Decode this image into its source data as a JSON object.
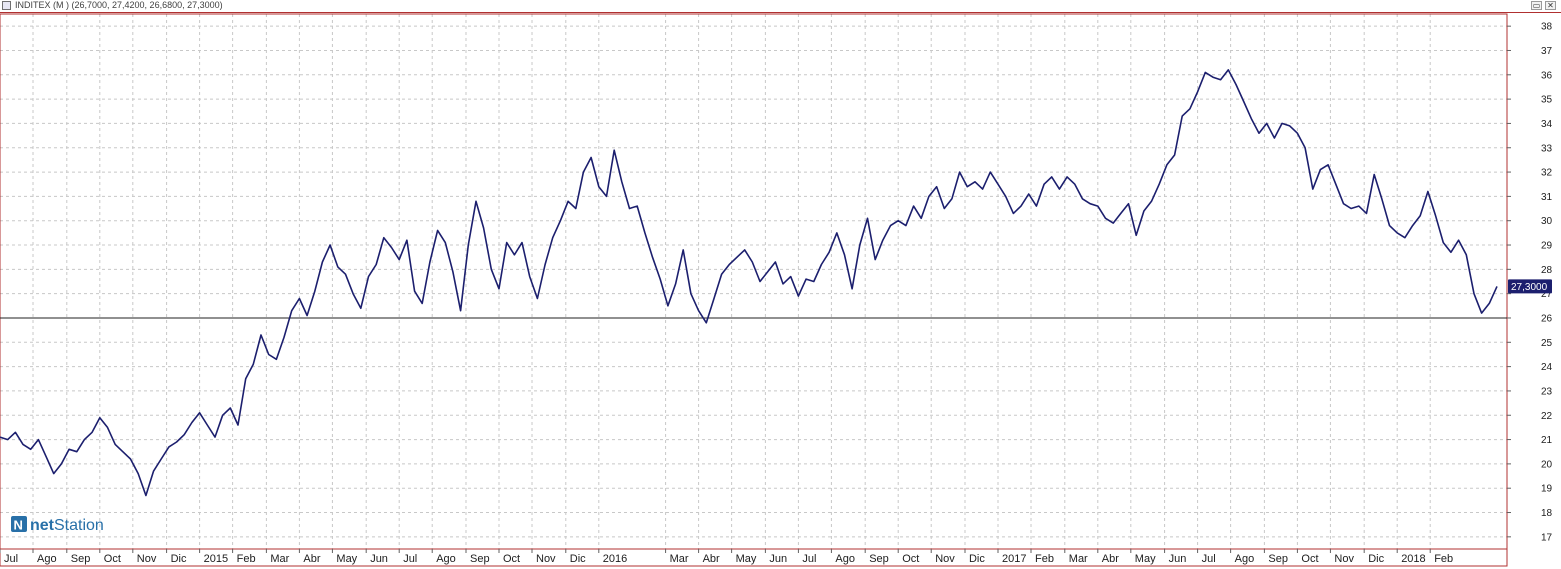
{
  "window": {
    "title": "INDITEX (M ) (26,7000, 27,4200, 26,6800, 27,3000)",
    "restore_symbol": "▭",
    "close_symbol": "✕"
  },
  "watermark": {
    "logo_letter": "N",
    "brand_bold": "net",
    "brand_rest": "Station"
  },
  "colors": {
    "price_line": "#1c1f6e",
    "frame": "#b03030",
    "grid": "#c8c8c8",
    "label_bg": "#1c1f6e",
    "logo": "#2870a8"
  },
  "chart_data": {
    "type": "line",
    "series": [
      {
        "name": "INDITEX",
        "values": [
          21.1,
          21.0,
          21.3,
          20.8,
          20.6,
          21.0,
          20.3,
          19.6,
          20.0,
          20.6,
          20.5,
          21.0,
          21.3,
          21.9,
          21.5,
          20.8,
          20.5,
          20.2,
          19.6,
          18.7,
          19.7,
          20.2,
          20.7,
          20.9,
          21.2,
          21.7,
          22.1,
          21.6,
          21.1,
          22.0,
          22.3,
          21.6,
          23.5,
          24.1,
          25.3,
          24.5,
          24.3,
          25.2,
          26.3,
          26.8,
          26.1,
          27.1,
          28.3,
          29.0,
          28.1,
          27.8,
          27.0,
          26.4,
          27.7,
          28.2,
          29.3,
          28.9,
          28.4,
          29.2,
          27.1,
          26.6,
          28.3,
          29.6,
          29.1,
          27.9,
          26.3,
          29.0,
          30.8,
          29.7,
          28.0,
          27.2,
          29.1,
          28.6,
          29.1,
          27.7,
          26.8,
          28.2,
          29.3,
          30.0,
          30.8,
          30.5,
          32.0,
          32.6,
          31.4,
          31.0,
          32.9,
          31.6,
          30.5,
          30.6,
          29.5,
          28.5,
          27.6,
          26.5,
          27.4,
          28.8,
          27.0,
          26.3,
          25.8,
          26.8,
          27.8,
          28.2,
          28.5,
          28.8,
          28.3,
          27.5,
          27.9,
          28.3,
          27.4,
          27.7,
          26.9,
          27.6,
          27.5,
          28.2,
          28.7,
          29.5,
          28.6,
          27.2,
          29.0,
          30.1,
          28.4,
          29.2,
          29.8,
          30.0,
          29.8,
          30.6,
          30.1,
          31.0,
          31.4,
          30.5,
          30.9,
          32.0,
          31.4,
          31.6,
          31.3,
          32.0,
          31.5,
          31.0,
          30.3,
          30.6,
          31.1,
          30.6,
          31.5,
          31.8,
          31.3,
          31.8,
          31.5,
          30.9,
          30.7,
          30.6,
          30.1,
          29.9,
          30.3,
          30.7,
          29.4,
          30.4,
          30.8,
          31.5,
          32.3,
          32.7,
          34.3,
          34.6,
          35.3,
          36.1,
          35.9,
          35.8,
          36.2,
          35.6,
          34.9,
          34.2,
          33.6,
          34.0,
          33.4,
          34.0,
          33.9,
          33.6,
          33.0,
          31.3,
          32.1,
          32.3,
          31.5,
          30.7,
          30.5,
          30.6,
          30.3,
          31.9,
          30.9,
          29.8,
          29.5,
          29.3,
          29.8,
          30.2,
          31.2,
          30.2,
          29.1,
          28.7,
          29.2,
          28.6,
          27.0,
          26.2,
          26.6,
          27.3
        ]
      }
    ],
    "x_ticks": [
      "Jul",
      "Ago",
      "Sep",
      "Oct",
      "Nov",
      "Dic",
      "2015",
      "Feb",
      "Mar",
      "Abr",
      "May",
      "Jun",
      "Jul",
      "Ago",
      "Sep",
      "Oct",
      "Nov",
      "Dic",
      "2016",
      "Mar",
      "Abr",
      "May",
      "Jun",
      "Jul",
      "Ago",
      "Sep",
      "Oct",
      "Nov",
      "Dic",
      "2017",
      "Feb",
      "Mar",
      "Abr",
      "May",
      "Jun",
      "Jul",
      "Ago",
      "Sep",
      "Oct",
      "Nov",
      "Dic",
      "2018",
      "Feb"
    ],
    "x_tick_index": [
      0,
      4.3,
      8.7,
      13.0,
      17.3,
      21.7,
      26.0,
      30.3,
      34.7,
      39.0,
      43.3,
      47.7,
      52.0,
      56.3,
      60.7,
      65.0,
      69.3,
      73.7,
      78.0,
      86.7,
      91.0,
      95.3,
      99.7,
      104.0,
      108.3,
      112.7,
      117.0,
      121.3,
      125.7,
      130.0,
      134.3,
      138.7,
      143.0,
      147.3,
      151.7,
      156.0,
      160.3,
      164.7,
      169.0,
      173.3,
      177.7,
      182.0,
      186.3
    ],
    "y_ticks": [
      17,
      18,
      19,
      20,
      21,
      22,
      23,
      24,
      25,
      26,
      27,
      28,
      29,
      30,
      31,
      32,
      33,
      34,
      35,
      36,
      37,
      38
    ],
    "ylim": [
      16.5,
      38.5
    ],
    "horizontal_line": 26,
    "last_price_label": "27,3000",
    "last_price": 27.3,
    "grid": true,
    "legend": "none"
  }
}
